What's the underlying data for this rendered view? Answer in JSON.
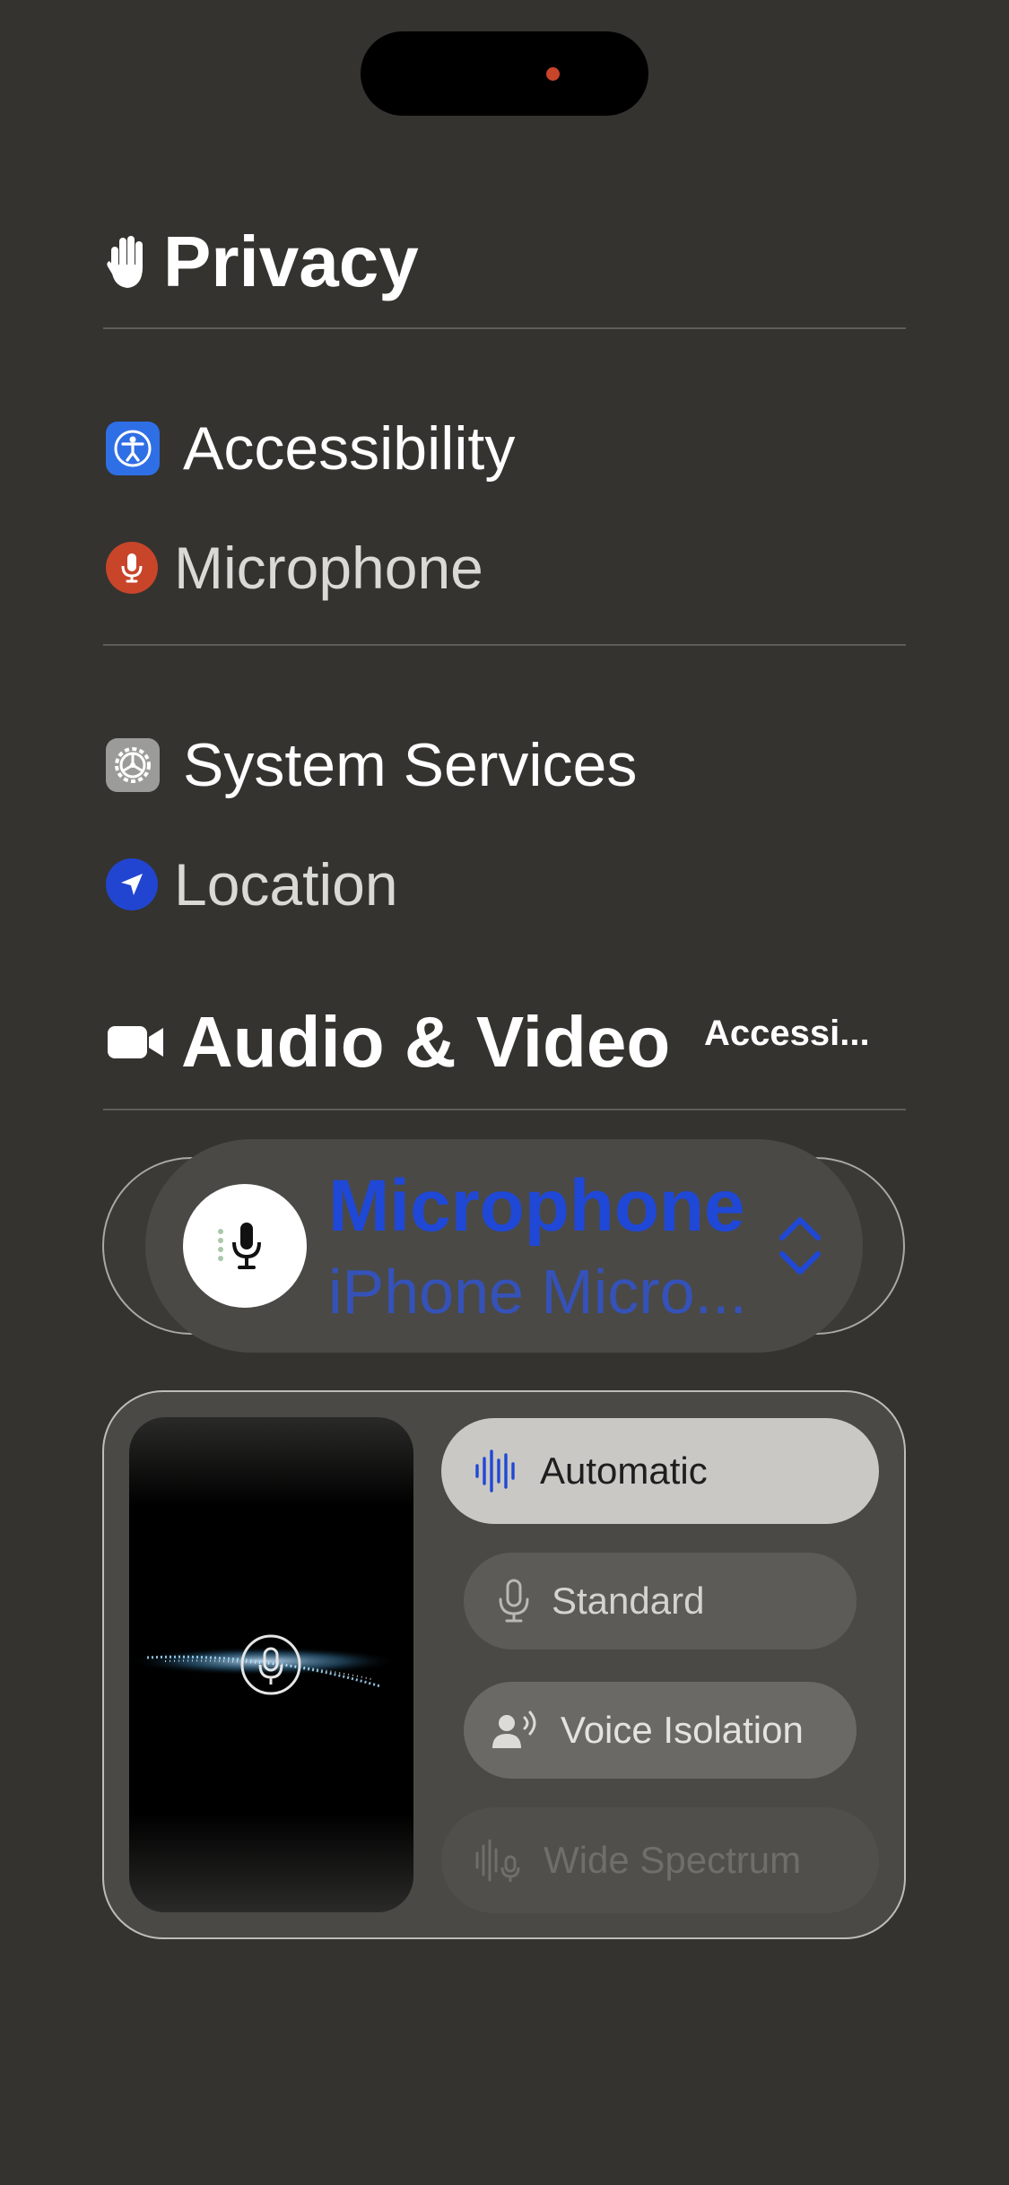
{
  "privacy": {
    "heading": "Privacy",
    "heading_icon": "hand-raised-icon",
    "groups": [
      {
        "title": "Accessibility",
        "title_icon": "accessibility-icon",
        "sub": "Microphone",
        "sub_icon": "microphone-icon",
        "sub_icon_color": "#c8452a"
      },
      {
        "title": "System Services",
        "title_icon": "gear-icon",
        "sub": "Location",
        "sub_icon": "location-arrow-icon",
        "sub_icon_color": "#2145d0"
      }
    ]
  },
  "audio_video": {
    "heading": "Audio & Video",
    "heading_icon": "video-camera-icon",
    "side_label": "Accessi..."
  },
  "mic_control": {
    "title": "Microphone",
    "subtitle": "iPhone Micro...",
    "accent_color": "#2048d6",
    "icon": "microphone-icon",
    "selector_icon": "chevron-up-down-icon"
  },
  "mic_modes": [
    {
      "label": "Automatic",
      "icon": "waveform-icon",
      "selected": true
    },
    {
      "label": "Standard",
      "icon": "microphone-icon",
      "selected": false
    },
    {
      "label": "Voice Isolation",
      "icon": "person-wave-icon",
      "selected": false
    },
    {
      "label": "Wide Spectrum",
      "icon": "waveform-mic-icon",
      "selected": false,
      "disabled": true
    }
  ]
}
